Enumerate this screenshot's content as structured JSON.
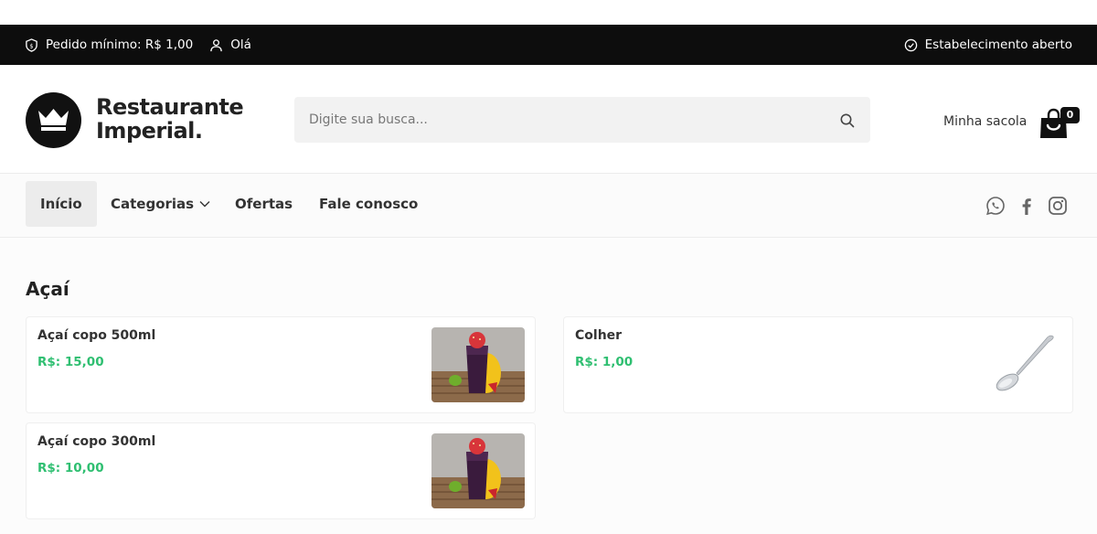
{
  "topbar": {
    "min_order": "Pedido mínimo: R$ 1,00",
    "greeting": "Olá",
    "status": "Estabelecimento aberto"
  },
  "header": {
    "brand_line1": "Restaurante",
    "brand_line2": "Imperial.",
    "search_placeholder": "Digite sua busca...",
    "bag_label": "Minha sacola",
    "bag_count": "0"
  },
  "nav": {
    "items": [
      {
        "label": "Início"
      },
      {
        "label": "Categorias"
      },
      {
        "label": "Ofertas"
      },
      {
        "label": "Fale conosco"
      }
    ],
    "socials": [
      "whatsapp-icon",
      "facebook-icon",
      "instagram-icon"
    ]
  },
  "section": {
    "title": "Açaí",
    "products": [
      {
        "name": "Açaí copo 500ml",
        "price": "R$: 15,00",
        "image": "acai-cup"
      },
      {
        "name": "Colher",
        "price": "R$: 1,00",
        "image": "spoon"
      },
      {
        "name": "Açaí copo 300ml",
        "price": "R$: 10,00",
        "image": "acai-cup"
      }
    ]
  },
  "colors": {
    "topbar_bg": "#0d0d0d",
    "price_green": "#2fbf71",
    "search_bg": "#f2f2f2"
  }
}
